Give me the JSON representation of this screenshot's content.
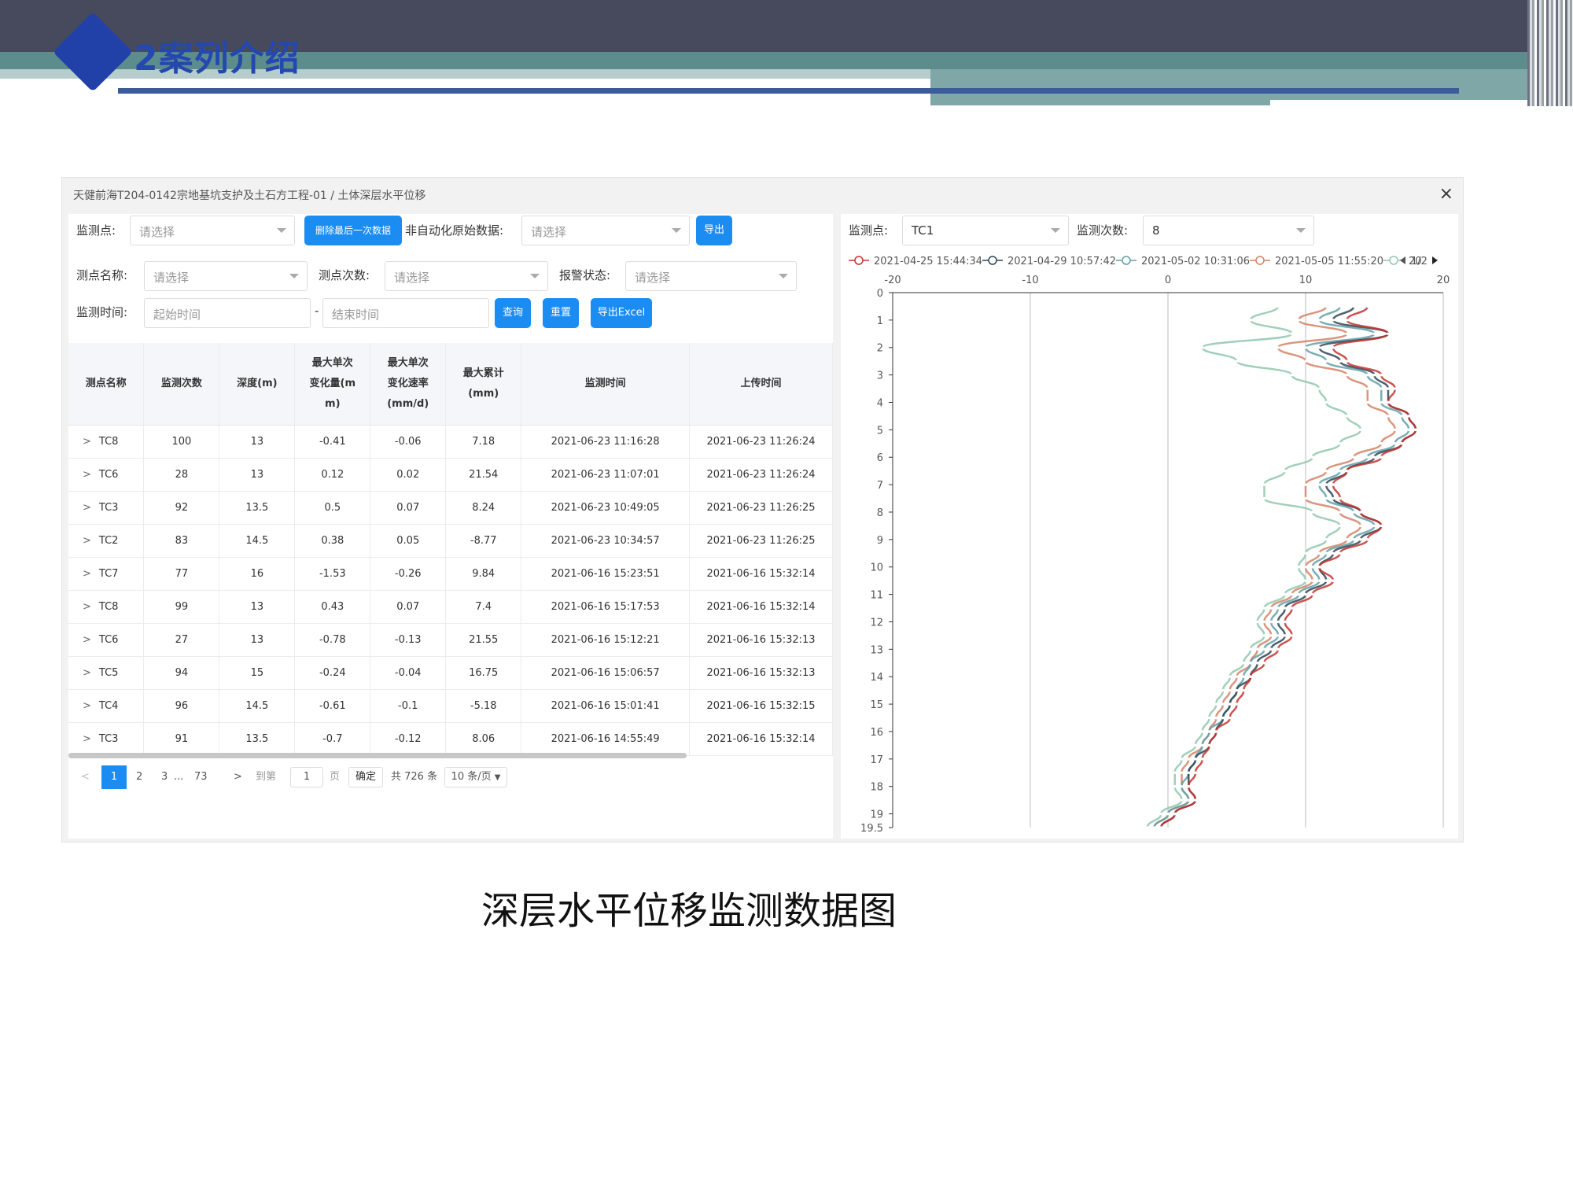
{
  "slide": {
    "title": "2案列介绍",
    "caption": "深层水平位移监测数据图"
  },
  "window": {
    "breadcrumb": "天健前海T204-0142宗地基坑支护及土石方工程-01 / 土体深层水平位移",
    "close": "×"
  },
  "filters": {
    "point_label": "监测点:",
    "point_placeholder": "请选择",
    "delete_button": "删除最后一次数据",
    "raw_label": "非自动化原始数据:",
    "raw_placeholder": "请选择",
    "export_button": "导出",
    "name_label": "测点名称:",
    "name_placeholder": "请选择",
    "count_label": "测点次数:",
    "count_placeholder": "请选择",
    "alarm_label": "报警状态:",
    "alarm_placeholder": "请选择",
    "time_label": "监测时间:",
    "start_placeholder": "起始时间",
    "dash": "-",
    "end_placeholder": "结束时间",
    "query_button": "查询",
    "reset_button": "重置",
    "excel_button": "导出Excel"
  },
  "table": {
    "headers": [
      "测点名称",
      "监测次数",
      "深度(m)",
      "最大单次\n变化量(m\nm)",
      "最大单次\n变化速率\n(mm/d)",
      "最大累计\n(mm)",
      "监测时间",
      "上传时间"
    ],
    "rows": [
      [
        "TC8",
        "100",
        "13",
        "-0.41",
        "-0.06",
        "7.18",
        "2021-06-23 11:16:28",
        "2021-06-23 11:26:24"
      ],
      [
        "TC6",
        "28",
        "13",
        "0.12",
        "0.02",
        "21.54",
        "2021-06-23 11:07:01",
        "2021-06-23 11:26:24"
      ],
      [
        "TC3",
        "92",
        "13.5",
        "0.5",
        "0.07",
        "8.24",
        "2021-06-23 10:49:05",
        "2021-06-23 11:26:25"
      ],
      [
        "TC2",
        "83",
        "14.5",
        "0.38",
        "0.05",
        "-8.77",
        "2021-06-23 10:34:57",
        "2021-06-23 11:26:25"
      ],
      [
        "TC7",
        "77",
        "16",
        "-1.53",
        "-0.26",
        "9.84",
        "2021-06-16 15:23:51",
        "2021-06-16 15:32:14"
      ],
      [
        "TC8",
        "99",
        "13",
        "0.43",
        "0.07",
        "7.4",
        "2021-06-16 15:17:53",
        "2021-06-16 15:32:14"
      ],
      [
        "TC6",
        "27",
        "13",
        "-0.78",
        "-0.13",
        "21.55",
        "2021-06-16 15:12:21",
        "2021-06-16 15:32:13"
      ],
      [
        "TC5",
        "94",
        "15",
        "-0.24",
        "-0.04",
        "16.75",
        "2021-06-16 15:06:57",
        "2021-06-16 15:32:13"
      ],
      [
        "TC4",
        "96",
        "14.5",
        "-0.61",
        "-0.1",
        "-5.18",
        "2021-06-16 15:01:41",
        "2021-06-16 15:32:15"
      ],
      [
        "TC3",
        "91",
        "13.5",
        "-0.7",
        "-0.12",
        "8.06",
        "2021-06-16 14:55:49",
        "2021-06-16 15:32:14"
      ]
    ]
  },
  "pager": {
    "prev": "<",
    "p1": "1",
    "p2": "2",
    "p3": "3",
    "ellipsis": "...",
    "last": "73",
    "next": ">",
    "goto": "到第",
    "goto_value": "1",
    "page_unit": "页",
    "confirm": "确定",
    "total": "共 726 条",
    "size": "10 条/页"
  },
  "chart_panel": {
    "point_label": "监测点:",
    "point_value": "TC1",
    "count_label": "监测次数:",
    "count_value": "8",
    "legend_page": "1/2"
  },
  "chart_data": {
    "type": "line",
    "xlim": [
      -20,
      20
    ],
    "ylim": [
      0,
      19.5
    ],
    "x_ticks": [
      "-20",
      "-10",
      "0",
      "10",
      "20"
    ],
    "y_ticks": [
      "0",
      "1",
      "2",
      "3",
      "4",
      "5",
      "6",
      "7",
      "8",
      "9",
      "10",
      "11",
      "12",
      "13",
      "14",
      "15",
      "16",
      "17",
      "18",
      "19",
      "19.5"
    ],
    "y_inverted": true,
    "grid": "vertical",
    "legend_placement": "top",
    "depths": [
      0.5,
      1.0,
      1.5,
      2.0,
      2.5,
      3.0,
      3.5,
      4.0,
      4.5,
      5.0,
      5.5,
      6.0,
      6.5,
      7.0,
      7.5,
      8.0,
      8.5,
      9.0,
      9.5,
      10.0,
      10.5,
      11.0,
      11.5,
      12.0,
      12.5,
      13.0,
      13.5,
      14.0,
      14.5,
      15.0,
      15.5,
      16.0,
      16.5,
      17.0,
      17.5,
      18.0,
      18.5,
      19.0,
      19.5
    ],
    "series": [
      {
        "name": "2021-04-25 15:44:34",
        "color": "#c23531",
        "values": [
          14.5,
          13,
          16,
          12,
          13,
          15.5,
          16.5,
          16,
          17.5,
          18,
          17,
          15.5,
          13,
          12,
          12.5,
          14,
          15.5,
          14.5,
          12.5,
          11,
          12,
          10.5,
          9,
          8.5,
          9,
          8,
          7,
          6,
          5.5,
          5,
          4.5,
          3.5,
          3,
          2.5,
          2,
          1.5,
          2,
          0.5,
          -0.5
        ]
      },
      {
        "name": "2021-04-29 10:57:42",
        "color": "#2f4554",
        "values": [
          13.5,
          12,
          16,
          11,
          12.5,
          15,
          16,
          16,
          17.5,
          18,
          17,
          15,
          13,
          11.5,
          12,
          14,
          15.5,
          14,
          12,
          11,
          11.5,
          10,
          8.5,
          8,
          8.5,
          7.5,
          6.5,
          6,
          5,
          4.5,
          4,
          3.5,
          3,
          2,
          1.5,
          1.5,
          2,
          0.5,
          -0.5
        ]
      },
      {
        "name": "2021-05-02 10:31:06",
        "color": "#61a0a8",
        "values": [
          12.5,
          11,
          15,
          10,
          11.5,
          14.5,
          15.5,
          15.5,
          17,
          17.5,
          16.5,
          14.5,
          12.5,
          11,
          11.5,
          13.5,
          15,
          13.5,
          11.5,
          10.5,
          11,
          9.5,
          8,
          7.5,
          8,
          7,
          6,
          5.5,
          5,
          4.5,
          4,
          3,
          2.5,
          2,
          1.5,
          1,
          1.5,
          0,
          -1
        ]
      },
      {
        "name": "2021-05-05 11:55:20",
        "color": "#d48265",
        "values": [
          11.5,
          9.5,
          13,
          8,
          10,
          13,
          14.5,
          14.5,
          16,
          16.5,
          15.5,
          13.5,
          11.5,
          10,
          10,
          12.5,
          14,
          13,
          11,
          10,
          10.5,
          9,
          7.5,
          7,
          7.5,
          6.5,
          6,
          5,
          4.5,
          4,
          3.5,
          3,
          2.5,
          1.5,
          1,
          1,
          1.5,
          0,
          -1
        ]
      },
      {
        "name": "20",
        "color": "#91c7ae",
        "values": [
          8,
          6,
          9,
          2.5,
          5,
          9,
          11,
          11.5,
          13,
          14,
          12.5,
          10.5,
          8.5,
          7,
          7,
          10.5,
          12.5,
          11.5,
          10,
          9.5,
          10,
          8.5,
          7,
          6.5,
          7,
          6,
          5.5,
          4.5,
          4,
          3.5,
          3,
          2.5,
          2,
          1,
          0.5,
          0.5,
          1,
          -0.5,
          -1.5
        ]
      }
    ]
  }
}
